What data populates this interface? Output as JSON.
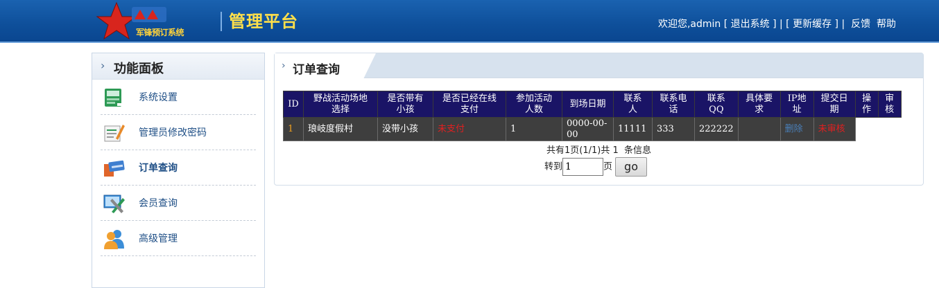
{
  "header": {
    "brand_text": "军锋预订系统",
    "platform_title": "管理平台",
    "welcome": "欢迎您,admin",
    "logout_label": "退出系统",
    "refresh_cache_label": "更新缓存",
    "feedback_label": "反馈",
    "help_label": "帮助"
  },
  "sidebar": {
    "title": "功能面板",
    "items": [
      {
        "label": "系统设置",
        "icon": "settings-window-icon"
      },
      {
        "label": "管理员修改密码",
        "icon": "edit-document-icon"
      },
      {
        "label": "订单查询",
        "icon": "cards-icon"
      },
      {
        "label": "会员查询",
        "icon": "tools-monitor-icon"
      },
      {
        "label": "高级管理",
        "icon": "users-icon"
      }
    ]
  },
  "main": {
    "tab_title": "订单查询",
    "table": {
      "headers": [
        "ID",
        "野战活动场地选择",
        "是否带有小孩",
        "是否已经在线支付",
        "参加活动人数",
        "到场日期",
        "联系人",
        "联系电话",
        "联系QQ",
        "具体要求",
        "IP地址",
        "提交日期",
        "操作",
        "审核"
      ],
      "header_lines": [
        [
          "ID"
        ],
        [
          "野战活动场地",
          "选择"
        ],
        [
          "是否带有",
          "小孩"
        ],
        [
          "是否已经在线",
          "支付"
        ],
        [
          "参加活动",
          "人数"
        ],
        [
          "到场日期"
        ],
        [
          "联系",
          "人"
        ],
        [
          "联系电",
          "话"
        ],
        [
          "联系",
          "QQ"
        ],
        [
          "具体要",
          "求"
        ],
        [
          "IP地",
          "址"
        ],
        [
          "提交日",
          "期"
        ],
        [
          "操",
          "作"
        ],
        [
          "审",
          "核"
        ]
      ],
      "rows": [
        {
          "id": "1",
          "venue": "琅岐度假村",
          "with_child": "没带小孩",
          "paid": "未支付",
          "people": "1",
          "date": "0000-00-00",
          "contact": "11111",
          "phone": "333",
          "qq": "222222",
          "requirement": "",
          "ip_action": "删除",
          "audit": "未审核"
        }
      ]
    },
    "pager": {
      "summary": "共有1页(1/1)共 1  条信息",
      "goto_label": "转到",
      "page_value": "1",
      "page_unit": "页",
      "go_label": "go"
    }
  },
  "colors": {
    "header_bg": "#0e4f9a",
    "title_yellow": "#ffe04a",
    "table_header_bg": "#1a1466",
    "table_row_bg": "#3e3e3e",
    "status_red": "#e02020",
    "link_blue": "#4a7fb8",
    "id_orange": "#f0a020"
  }
}
